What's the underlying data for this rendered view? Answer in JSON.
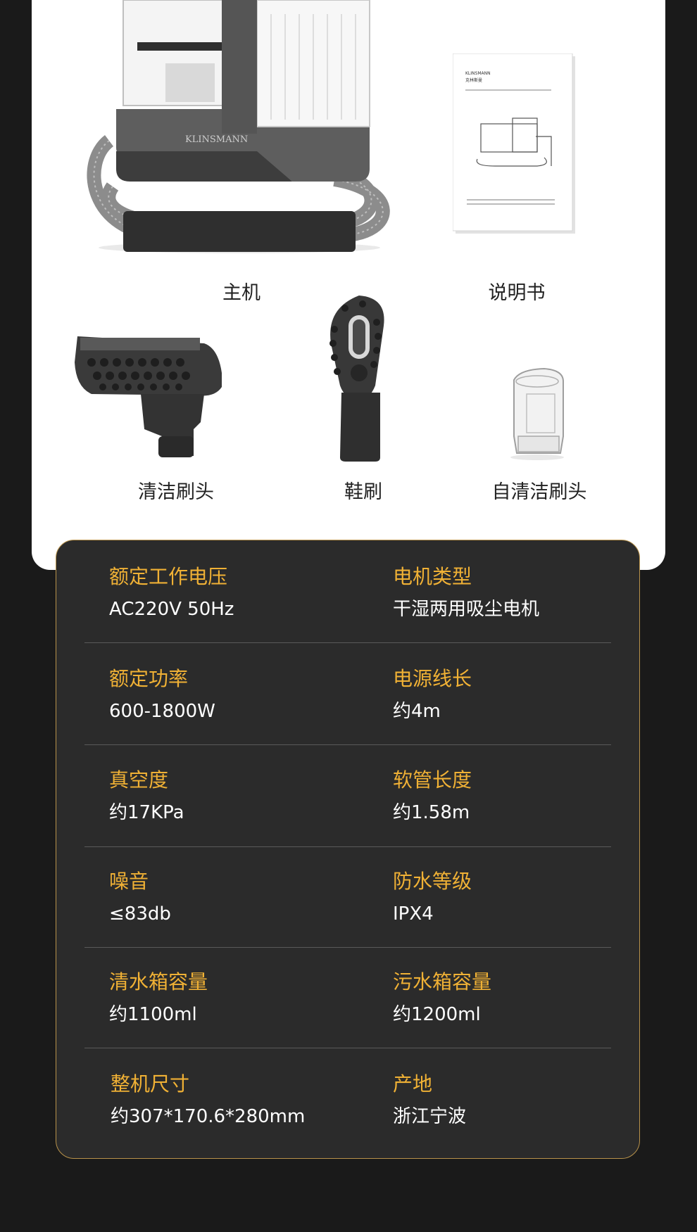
{
  "items": {
    "main_unit": "主机",
    "manual": "说明书",
    "cleaning_brush": "清洁刷头",
    "shoe_brush": "鞋刷",
    "self_clean_brush": "自清洁刷头"
  },
  "product": {
    "brand_logo": "KLINSMANN",
    "manual_brand": "KLINSMANN",
    "manual_brand_cn": "克林斯曼"
  },
  "specs": [
    {
      "left": {
        "label": "额定工作电压",
        "value": "AC220V 50Hz"
      },
      "right": {
        "label": "电机类型",
        "value": "干湿两用吸尘电机"
      }
    },
    {
      "left": {
        "label": "额定功率",
        "value": "600-1800W"
      },
      "right": {
        "label": "电源线长",
        "value": "约4m"
      }
    },
    {
      "left": {
        "label": "真空度",
        "value": "约17KPa"
      },
      "right": {
        "label": "软管长度",
        "value": "约1.58m"
      }
    },
    {
      "left": {
        "label": "噪音",
        "value": "≤83db"
      },
      "right": {
        "label": "防水等级",
        "value": "IPX4"
      }
    },
    {
      "left": {
        "label": "清水箱容量",
        "value": "约1100ml"
      },
      "right": {
        "label": "污水箱容量",
        "value": "约1200ml"
      }
    },
    {
      "left": {
        "label": "整机尺寸",
        "value": "约307*170.6*280mm"
      },
      "right": {
        "label": "产地",
        "value": "浙江宁波"
      }
    }
  ],
  "colors": {
    "accent": "#f0b135",
    "panel": "#2b2b2b",
    "background": "#1a1a1a",
    "border": "#b8924a"
  }
}
